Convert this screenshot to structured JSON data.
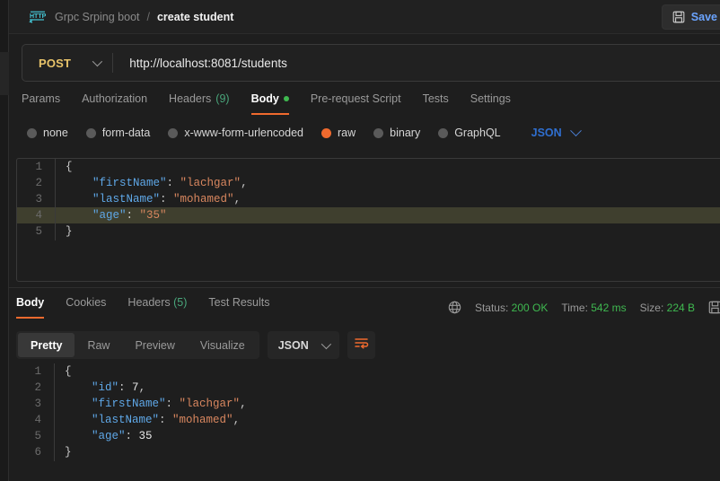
{
  "topbar": {
    "icon": "http-protocol-icon",
    "breadcrumb_parent": "Grpc Srping boot",
    "breadcrumb_separator": "/",
    "breadcrumb_current": "create student",
    "save_label": "Save",
    "save_icon": "floppy-disk-icon"
  },
  "url_bar": {
    "method": "POST",
    "url": "http://localhost:8081/students",
    "method_color": "#e9c46a"
  },
  "request_tabs": [
    {
      "label": "Params",
      "count": "",
      "active": false,
      "dot": false
    },
    {
      "label": "Authorization",
      "count": "",
      "active": false,
      "dot": false
    },
    {
      "label": "Headers",
      "count": "(9)",
      "active": false,
      "dot": false
    },
    {
      "label": "Body",
      "count": "",
      "active": true,
      "dot": true
    },
    {
      "label": "Pre-request Script",
      "count": "",
      "active": false,
      "dot": false
    },
    {
      "label": "Tests",
      "count": "",
      "active": false,
      "dot": false
    },
    {
      "label": "Settings",
      "count": "",
      "active": false,
      "dot": false
    }
  ],
  "body_types": [
    {
      "label": "none",
      "selected": false
    },
    {
      "label": "form-data",
      "selected": false
    },
    {
      "label": "x-www-form-urlencoded",
      "selected": false
    },
    {
      "label": "raw",
      "selected": true
    },
    {
      "label": "binary",
      "selected": false
    },
    {
      "label": "GraphQL",
      "selected": false
    }
  ],
  "body_format": {
    "label": "JSON",
    "icon": "chevron-down-icon",
    "color": "#2f6fd0"
  },
  "request_body": {
    "lines": [
      {
        "no": "1",
        "highlight": false,
        "tokens": [
          {
            "t": "{",
            "c": "br"
          }
        ]
      },
      {
        "no": "2",
        "highlight": false,
        "tokens": [
          {
            "t": "    ",
            "c": "p"
          },
          {
            "t": "\"firstName\"",
            "c": "k"
          },
          {
            "t": ": ",
            "c": "p"
          },
          {
            "t": "\"lachgar\"",
            "c": "s"
          },
          {
            "t": ",",
            "c": "p"
          }
        ]
      },
      {
        "no": "3",
        "highlight": false,
        "tokens": [
          {
            "t": "    ",
            "c": "p"
          },
          {
            "t": "\"lastName\"",
            "c": "k"
          },
          {
            "t": ": ",
            "c": "p"
          },
          {
            "t": "\"mohamed\"",
            "c": "s"
          },
          {
            "t": ",",
            "c": "p"
          }
        ]
      },
      {
        "no": "4",
        "highlight": true,
        "tokens": [
          {
            "t": "    ",
            "c": "p"
          },
          {
            "t": "\"age\"",
            "c": "k"
          },
          {
            "t": ": ",
            "c": "p"
          },
          {
            "t": "\"35\"",
            "c": "s"
          }
        ]
      },
      {
        "no": "5",
        "highlight": false,
        "tokens": [
          {
            "t": "}",
            "c": "br"
          }
        ]
      }
    ]
  },
  "response_tabs": [
    {
      "label": "Body",
      "count": "",
      "active": true
    },
    {
      "label": "Cookies",
      "count": "",
      "active": false
    },
    {
      "label": "Headers",
      "count": "(5)",
      "active": false
    },
    {
      "label": "Test Results",
      "count": "",
      "active": false
    }
  ],
  "response_meta": {
    "globe_icon": "globe-icon",
    "status_label": "Status:",
    "status_value": "200 OK",
    "time_label": "Time:",
    "time_value": "542 ms",
    "size_label": "Size:",
    "size_value": "224 B",
    "save_response_icon": "floppy-disk-icon",
    "value_color": "#3fb950"
  },
  "response_toolbar": {
    "views": [
      {
        "label": "Pretty",
        "active": true
      },
      {
        "label": "Raw",
        "active": false
      },
      {
        "label": "Preview",
        "active": false
      },
      {
        "label": "Visualize",
        "active": false
      }
    ],
    "format": {
      "label": "JSON",
      "icon": "chevron-down-icon"
    },
    "wrap_icon": "word-wrap-icon"
  },
  "response_body": {
    "lines": [
      {
        "no": "1",
        "highlight": false,
        "tokens": [
          {
            "t": "{",
            "c": "br"
          }
        ]
      },
      {
        "no": "2",
        "highlight": false,
        "tokens": [
          {
            "t": "    ",
            "c": "p"
          },
          {
            "t": "\"id\"",
            "c": "k"
          },
          {
            "t": ": ",
            "c": "p"
          },
          {
            "t": "7",
            "c": "n"
          },
          {
            "t": ",",
            "c": "p"
          }
        ]
      },
      {
        "no": "3",
        "highlight": false,
        "tokens": [
          {
            "t": "    ",
            "c": "p"
          },
          {
            "t": "\"firstName\"",
            "c": "k"
          },
          {
            "t": ": ",
            "c": "p"
          },
          {
            "t": "\"lachgar\"",
            "c": "s"
          },
          {
            "t": ",",
            "c": "p"
          }
        ]
      },
      {
        "no": "4",
        "highlight": false,
        "tokens": [
          {
            "t": "    ",
            "c": "p"
          },
          {
            "t": "\"lastName\"",
            "c": "k"
          },
          {
            "t": ": ",
            "c": "p"
          },
          {
            "t": "\"mohamed\"",
            "c": "s"
          },
          {
            "t": ",",
            "c": "p"
          }
        ]
      },
      {
        "no": "5",
        "highlight": false,
        "tokens": [
          {
            "t": "    ",
            "c": "p"
          },
          {
            "t": "\"age\"",
            "c": "k"
          },
          {
            "t": ": ",
            "c": "p"
          },
          {
            "t": "35",
            "c": "n"
          }
        ]
      },
      {
        "no": "6",
        "highlight": false,
        "tokens": [
          {
            "t": "}",
            "c": "br"
          }
        ]
      }
    ]
  }
}
